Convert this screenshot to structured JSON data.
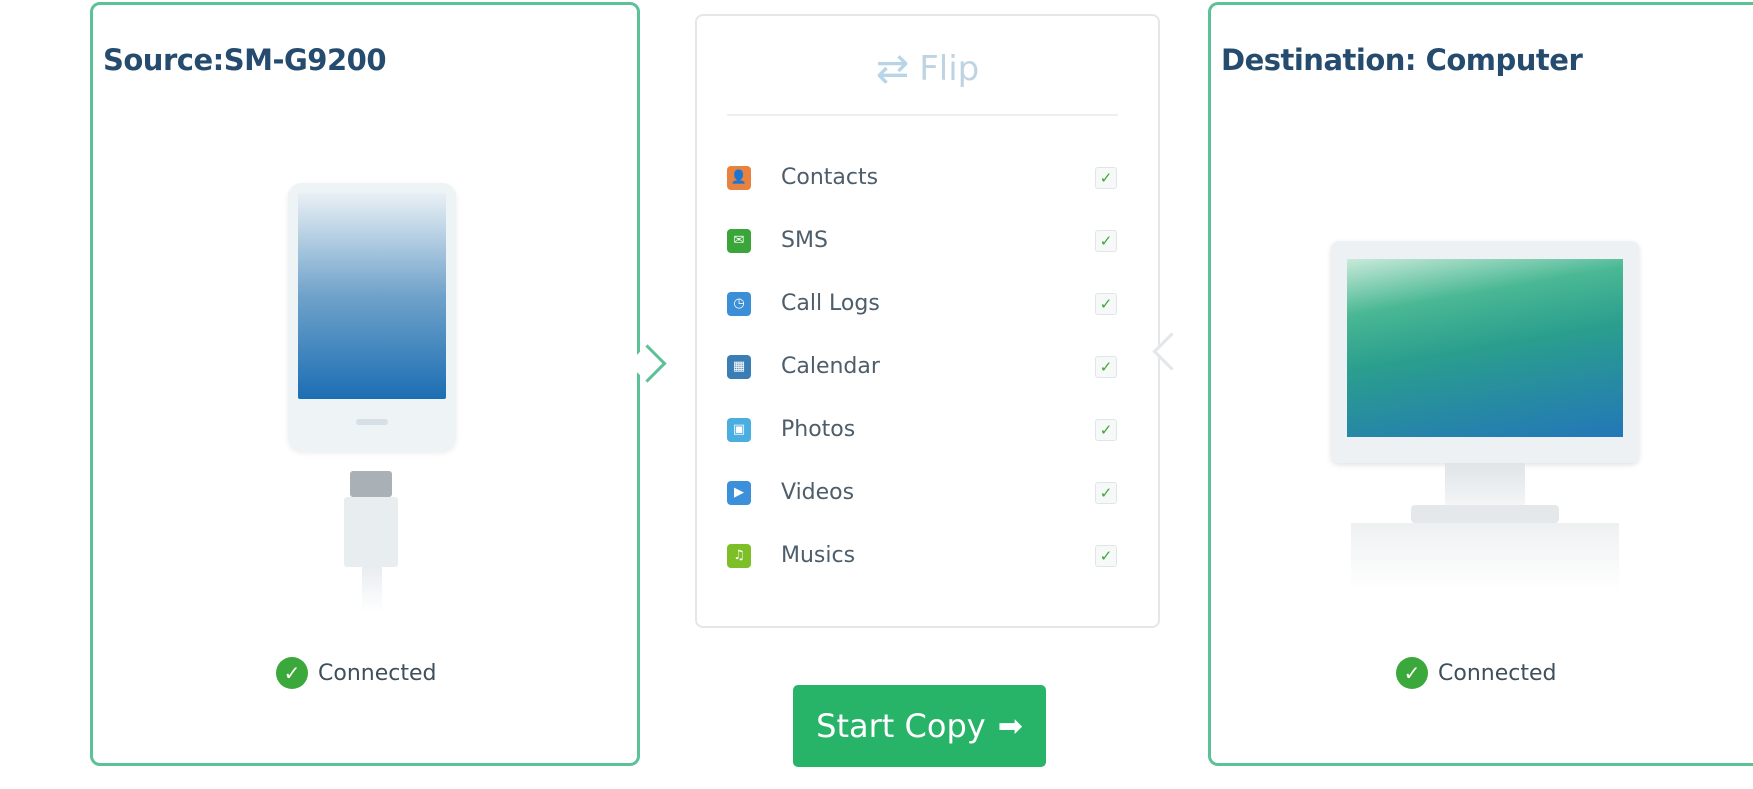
{
  "source": {
    "title": "Source:SM-G9200",
    "status": "Connected",
    "status_icon": "check-circle-icon",
    "device_icon": "phone-icon"
  },
  "destination": {
    "title": "Destination: Computer",
    "status": "Connected",
    "status_icon": "check-circle-icon",
    "device_icon": "monitor-icon"
  },
  "flip": {
    "label": "Flip",
    "icon": "swap-arrows-icon"
  },
  "items": [
    {
      "label": "Contacts",
      "icon": "contacts-icon",
      "color": "#e8823e",
      "checked": true
    },
    {
      "label": "SMS",
      "icon": "sms-icon",
      "color": "#3aa63a",
      "checked": true
    },
    {
      "label": "Call Logs",
      "icon": "call-logs-icon",
      "color": "#3b8fd6",
      "checked": true
    },
    {
      "label": "Calendar",
      "icon": "calendar-icon",
      "color": "#3b7eb6",
      "checked": true
    },
    {
      "label": "Photos",
      "icon": "photos-icon",
      "color": "#4aaee0",
      "checked": true
    },
    {
      "label": "Videos",
      "icon": "videos-icon",
      "color": "#3c8fdb",
      "checked": true
    },
    {
      "label": "Musics",
      "icon": "musics-icon",
      "color": "#7cbf26",
      "checked": true
    }
  ],
  "start_copy": {
    "label": "Start Copy",
    "icon": "arrow-right-icon",
    "color": "#27b468"
  },
  "colors": {
    "panel_border": "#5cc197",
    "title": "#254b6e",
    "connected_badge": "#3aa83a"
  }
}
